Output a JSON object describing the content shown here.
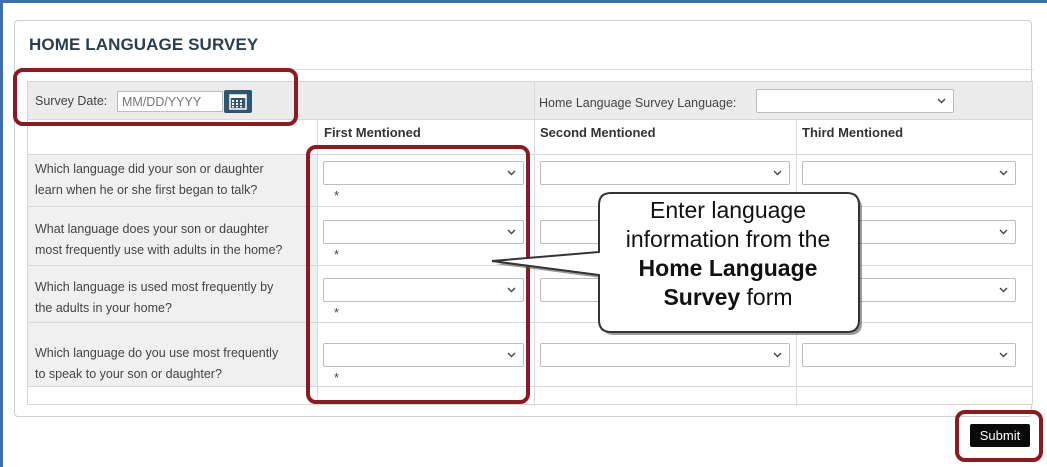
{
  "form": {
    "title": "HOME LANGUAGE SURVEY",
    "survey_date_label": "Survey Date:",
    "survey_date_placeholder": "MM/DD/YYYY",
    "hls_language_label": "Home Language Survey Language:",
    "columns": [
      "First Mentioned",
      "Second Mentioned",
      "Third Mentioned"
    ],
    "questions": [
      {
        "line1": "Which language did your son or daughter",
        "line2": "learn when he or she first began to talk?"
      },
      {
        "line1": "What language does your son or daughter",
        "line2": "most frequently use with adults in the home?"
      },
      {
        "line1": "Which language is used most frequently by",
        "line2": "the adults in your home?"
      },
      {
        "line1": "Which language do you use most frequently",
        "line2": "to speak to your son or daughter?"
      }
    ],
    "required_marker": "*",
    "submit_label": "Submit"
  },
  "callout": {
    "line1": "Enter language",
    "line2": "information from the",
    "line3": "Home Language",
    "line4_bold": "Survey",
    "line4_rest": " form"
  },
  "colors": {
    "accent_frame": "#3f6fa8",
    "highlight": "#8b1b22",
    "calendar_button": "#2f5570",
    "submit_button": "#0a0a0a"
  },
  "icons": {
    "calendar": "calendar-icon",
    "dropdown": "chevron-down-icon"
  }
}
